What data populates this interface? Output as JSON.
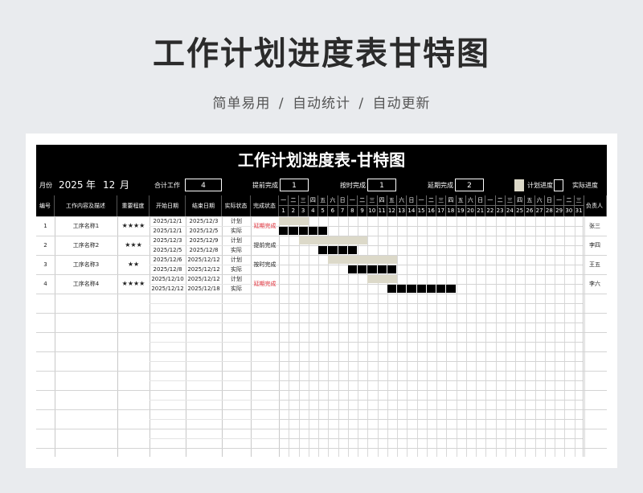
{
  "page": {
    "title": "工作计划进度表甘特图",
    "subtitle": "简单易用 / 自动统计 / 自动更新"
  },
  "sheet": {
    "title": "工作计划进度表-甘特图",
    "info": {
      "month_label": "月份",
      "year": "2025",
      "year_unit": "年",
      "month": "12",
      "month_unit": "月",
      "total_label": "合计工作",
      "total_value": "4",
      "early_label": "提前完成",
      "early_value": "1",
      "ontime_label": "按时完成",
      "ontime_value": "1",
      "late_label": "延期完成",
      "late_value": "2",
      "legend_plan": "计划进度",
      "legend_actual": "实际进度"
    },
    "headers": {
      "num": "编号",
      "desc": "工作内容及描述",
      "priority": "重要程度",
      "start": "开始日期",
      "end": "结束日期",
      "status": "实际状态",
      "done": "完成状态",
      "owner": "负责人"
    },
    "weekdays": [
      "一",
      "二",
      "三",
      "四",
      "五",
      "六",
      "日",
      "一",
      "二",
      "三",
      "四",
      "五",
      "六",
      "日",
      "一",
      "二",
      "三",
      "四",
      "五",
      "六",
      "日",
      "一",
      "二",
      "三",
      "四",
      "五",
      "六",
      "日",
      "一",
      "二",
      "三"
    ],
    "days": [
      "1",
      "2",
      "3",
      "4",
      "5",
      "6",
      "7",
      "8",
      "9",
      "10",
      "11",
      "12",
      "13",
      "14",
      "15",
      "16",
      "17",
      "18",
      "19",
      "20",
      "21",
      "22",
      "23",
      "24",
      "25",
      "26",
      "27",
      "28",
      "29",
      "30",
      "31"
    ],
    "tasks": [
      {
        "num": "1",
        "desc": "工序名称1",
        "priority": "★★★★",
        "plan_start": "2025/12/1",
        "plan_end": "2025/12/3",
        "actual_start": "2025/12/1",
        "actual_end": "2025/12/5",
        "plan_label": "计划",
        "actual_label": "实际",
        "done": "延期完成",
        "done_late": true,
        "owner": "张三",
        "plan_days": [
          1,
          3
        ],
        "actual_days": [
          1,
          5
        ]
      },
      {
        "num": "2",
        "desc": "工序名称2",
        "priority": "★★★",
        "plan_start": "2025/12/3",
        "plan_end": "2025/12/9",
        "actual_start": "2025/12/5",
        "actual_end": "2025/12/8",
        "plan_label": "计划",
        "actual_label": "实际",
        "done": "提前完成",
        "done_late": false,
        "owner": "李四",
        "plan_days": [
          3,
          9
        ],
        "actual_days": [
          5,
          8
        ]
      },
      {
        "num": "3",
        "desc": "工序名称3",
        "priority": "★★",
        "plan_start": "2025/12/6",
        "plan_end": "2025/12/12",
        "actual_start": "2025/12/8",
        "actual_end": "2025/12/12",
        "plan_label": "计划",
        "actual_label": "实际",
        "done": "按时完成",
        "done_late": false,
        "owner": "王五",
        "plan_days": [
          6,
          12
        ],
        "actual_days": [
          8,
          12
        ]
      },
      {
        "num": "4",
        "desc": "工序名称4",
        "priority": "★★★★",
        "plan_start": "2025/12/10",
        "plan_end": "2025/12/12",
        "actual_start": "2025/12/12",
        "actual_end": "2025/12/18",
        "plan_label": "计划",
        "actual_label": "实际",
        "done": "延期完成",
        "done_late": true,
        "owner": "李六",
        "plan_days": [
          10,
          12
        ],
        "actual_days": [
          12,
          18
        ]
      }
    ],
    "colors": {
      "plan": "#dcd9c9",
      "actual": "#000000",
      "late": "#e0303a"
    }
  }
}
